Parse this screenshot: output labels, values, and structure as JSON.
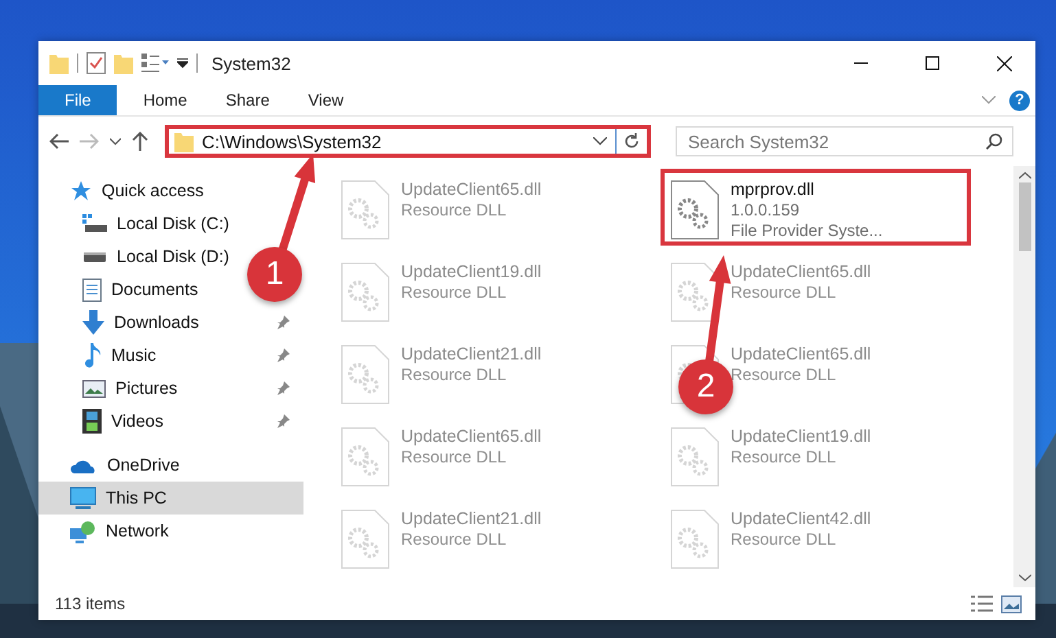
{
  "window": {
    "title": "System32"
  },
  "ribbon": {
    "tabs": [
      {
        "label": "File",
        "selected": true
      },
      {
        "label": "Home",
        "selected": false
      },
      {
        "label": "Share",
        "selected": false
      },
      {
        "label": "View",
        "selected": false
      }
    ],
    "help": "?"
  },
  "address": {
    "path": "C:\\Windows\\System32",
    "highlighted": true
  },
  "search": {
    "placeholder": "Search System32"
  },
  "sidebar": {
    "items": [
      {
        "label": "Quick access",
        "selected": false,
        "children": [
          {
            "label": "Local Disk (C:)"
          },
          {
            "label": "Local Disk (D:)"
          },
          {
            "label": "Documents"
          },
          {
            "label": "Downloads",
            "pinned": true
          },
          {
            "label": "Music",
            "pinned": true
          },
          {
            "label": "Pictures",
            "pinned": true
          },
          {
            "label": "Videos",
            "pinned": true
          }
        ]
      },
      {
        "label": "OneDrive",
        "selected": false
      },
      {
        "label": "This PC",
        "selected": true
      },
      {
        "label": "Network",
        "selected": false
      }
    ]
  },
  "files": [
    {
      "name": "UpdateClient65.dll",
      "lines": [
        "Resource DLL"
      ],
      "faded": true,
      "highlighted": false
    },
    {
      "name": "mprprov.dll",
      "lines": [
        "1.0.0.159",
        "File Provider Syste..."
      ],
      "faded": false,
      "highlighted": true
    },
    {
      "name": "UpdateClient19.dll",
      "lines": [
        "Resource DLL"
      ],
      "faded": true,
      "highlighted": false
    },
    {
      "name": "UpdateClient65.dll",
      "lines": [
        "Resource DLL"
      ],
      "faded": true,
      "highlighted": false
    },
    {
      "name": "UpdateClient21.dll",
      "lines": [
        "Resource DLL"
      ],
      "faded": true,
      "highlighted": false
    },
    {
      "name": "UpdateClient65.dll",
      "lines": [
        "Resource DLL"
      ],
      "faded": true,
      "highlighted": false
    },
    {
      "name": "UpdateClient65.dll",
      "lines": [
        "Resource DLL"
      ],
      "faded": true,
      "highlighted": false
    },
    {
      "name": "UpdateClient19.dll",
      "lines": [
        "Resource DLL"
      ],
      "faded": true,
      "highlighted": false
    },
    {
      "name": "UpdateClient21.dll",
      "lines": [
        "Resource DLL"
      ],
      "faded": true,
      "highlighted": false
    },
    {
      "name": "UpdateClient42.dll",
      "lines": [
        "Resource DLL"
      ],
      "faded": true,
      "highlighted": false
    }
  ],
  "status_bar": {
    "count": "113 items"
  },
  "annotations": [
    {
      "label": "1"
    },
    {
      "label": "2"
    }
  ]
}
